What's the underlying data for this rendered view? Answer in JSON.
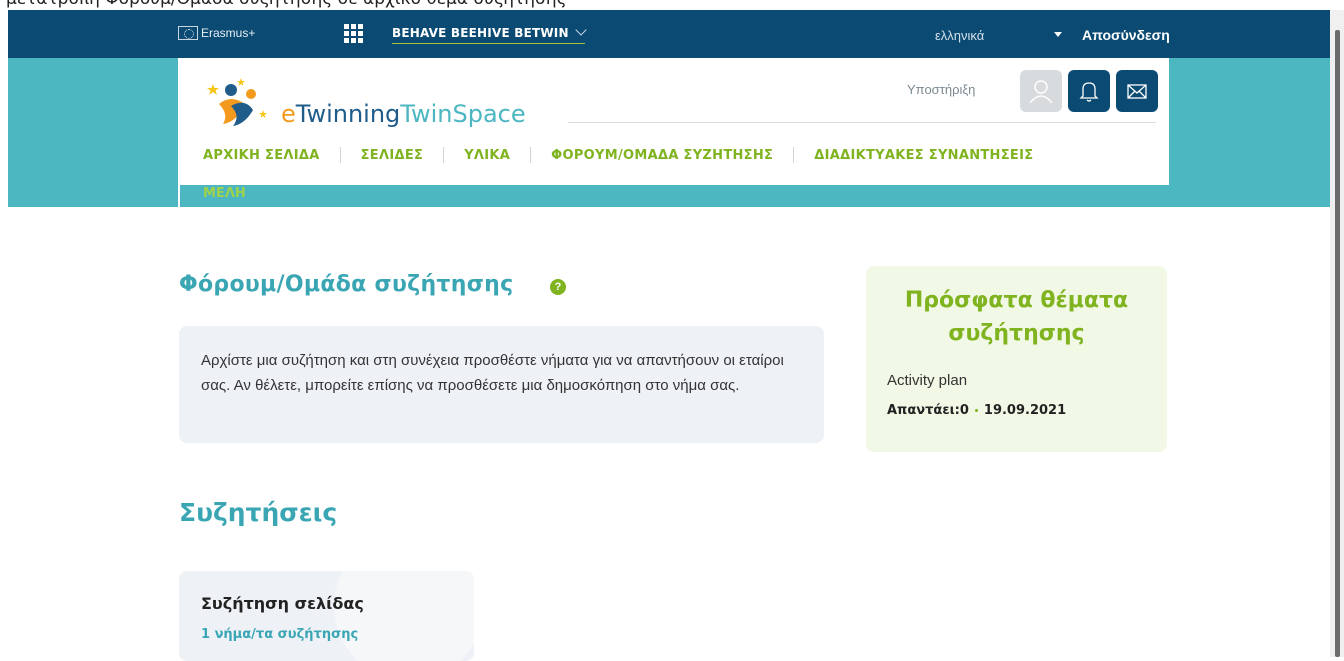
{
  "window_title_strip": "μετατροπή Φόρουμ/Ομάδα συζήτησης σε αρχικό θέμα συζήτησης",
  "topbar": {
    "erasmus": "Erasmus+",
    "project": "BEHAVE BEEHIVE BETWIN",
    "language": "ελληνικά",
    "logout": "Αποσύνδεση",
    "bg_color": "#0b4a73"
  },
  "header": {
    "logo_e": "e",
    "logo_twinning": "Twinning",
    "logo_twinspace": "TwinSpace",
    "support": "Υποστήριξη",
    "icons": [
      "user-icon",
      "bell-icon",
      "mail-icon"
    ],
    "accent": "#4cb6c1"
  },
  "nav": {
    "items": [
      "ΑΡΧΙΚΗ ΣΕΛΙΔΑ",
      "ΣΕΛΙΔΕΣ",
      "ΥΛΙΚΑ",
      "ΦΟΡΟΥΜ/ΟΜΑΔΑ ΣΥΖΗΤΗΣΗΣ",
      "ΔΙΑΔΙΚΤΥΑΚΕΣ ΣΥΝΑΝΤΗΣΕΙΣ"
    ],
    "second_row": "ΜΕΛΗ",
    "color": "#7fb31f"
  },
  "main": {
    "title": "Φόρουμ/Ομάδα συζήτησης",
    "help": "?",
    "intro": "Αρχίστε μια συζήτηση και στη συνέχεια προσθέστε νήματα για να απαντήσουν οι εταίροι σας. Αν θέλετε, μπορείτε επίσης να προσθέσετε μια δημοσκόπηση στο νήμα σας.",
    "discussions_title": "Συζητήσεις",
    "discussion_card": {
      "title": "Συζήτηση σελίδας",
      "subtitle": "1 νήμα/τα συζήτησης"
    }
  },
  "recent": {
    "title": "Πρόσφατα θέματα συζήτησης",
    "topic": "Activity plan",
    "replies": "Απαντάει:0",
    "date": "19.09.2021"
  }
}
